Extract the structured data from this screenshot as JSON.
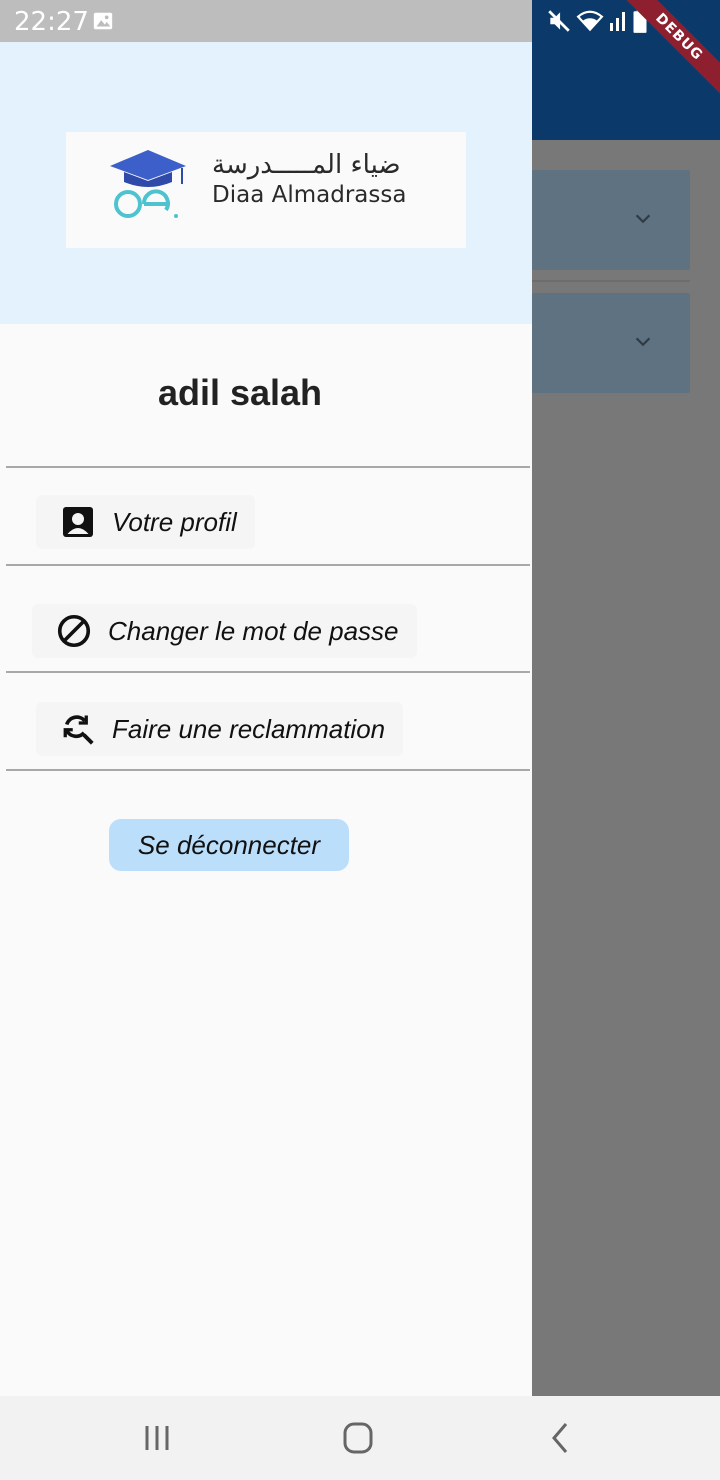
{
  "status_bar": {
    "time": "22:27",
    "icons": [
      "image-icon",
      "mute-icon",
      "wifi-icon",
      "signal-icon",
      "battery-icon"
    ]
  },
  "debug_banner": "DEBUG",
  "drawer": {
    "logo": {
      "arabic_text": "ضياء المـــــدرسة",
      "latin_text": "Diaa Almadrassa"
    },
    "user_name": "adil salah",
    "menu_items": [
      {
        "icon": "account-box-icon",
        "label": "Votre profil"
      },
      {
        "icon": "block-icon",
        "label": "Changer le mot de passe"
      },
      {
        "icon": "find-replace-icon",
        "label": "Faire une reclammation"
      }
    ],
    "logout_label": "Se déconnecter"
  },
  "background_app": {
    "cards": [
      {
        "icon": "chevron-down-icon"
      },
      {
        "icon": "chevron-down-icon"
      }
    ]
  },
  "nav_bar": {
    "buttons": [
      "recents-icon",
      "home-icon",
      "back-icon"
    ]
  },
  "colors": {
    "drawer_header_bg": "#e3f2fd",
    "logout_bg": "#bbdefb",
    "app_bar": "#0b3a6a",
    "debug_ribbon": "#8e1f2f"
  }
}
